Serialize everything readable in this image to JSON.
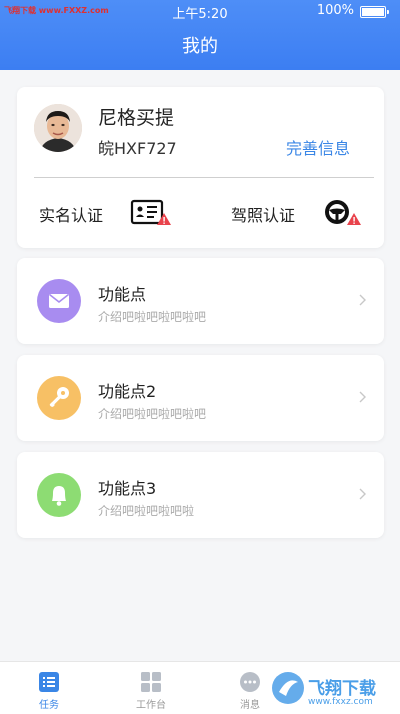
{
  "statusbar": {
    "watermark": "飞翔下载 www.FXXZ.com",
    "time": "上午5:20",
    "battery": "100%"
  },
  "header": {
    "title": "我的"
  },
  "profile": {
    "name": "尼格买提",
    "plate": "皖HXF727",
    "complete_info": "完善信息",
    "verify": [
      {
        "label": "实名认证",
        "icon": "id-card-icon",
        "warning": true
      },
      {
        "label": "驾照认证",
        "icon": "steering-wheel-icon",
        "warning": true
      }
    ]
  },
  "features": [
    {
      "title": "功能点",
      "desc": "介绍吧啦吧啦吧啦吧",
      "icon": "mail-icon",
      "color": "#a88cf0"
    },
    {
      "title": "功能点2",
      "desc": "介绍吧啦吧啦吧啦吧",
      "icon": "key-icon",
      "color": "#f7c065"
    },
    {
      "title": "功能点3",
      "desc": "介绍吧啦吧啦吧啦",
      "icon": "bell-icon",
      "color": "#8ddc73"
    }
  ],
  "tabs": [
    {
      "label": "任务",
      "icon": "list-icon",
      "active": true
    },
    {
      "label": "工作台",
      "icon": "grid-icon",
      "active": false
    },
    {
      "label": "消息",
      "icon": "chat-icon",
      "active": false
    }
  ],
  "watermark_bottom": {
    "text": "飞翔下载",
    "url": "www.fxxz.com"
  },
  "colors": {
    "accent": "#3c7ef2",
    "link": "#3a86e6",
    "warning": "#e9434c"
  }
}
